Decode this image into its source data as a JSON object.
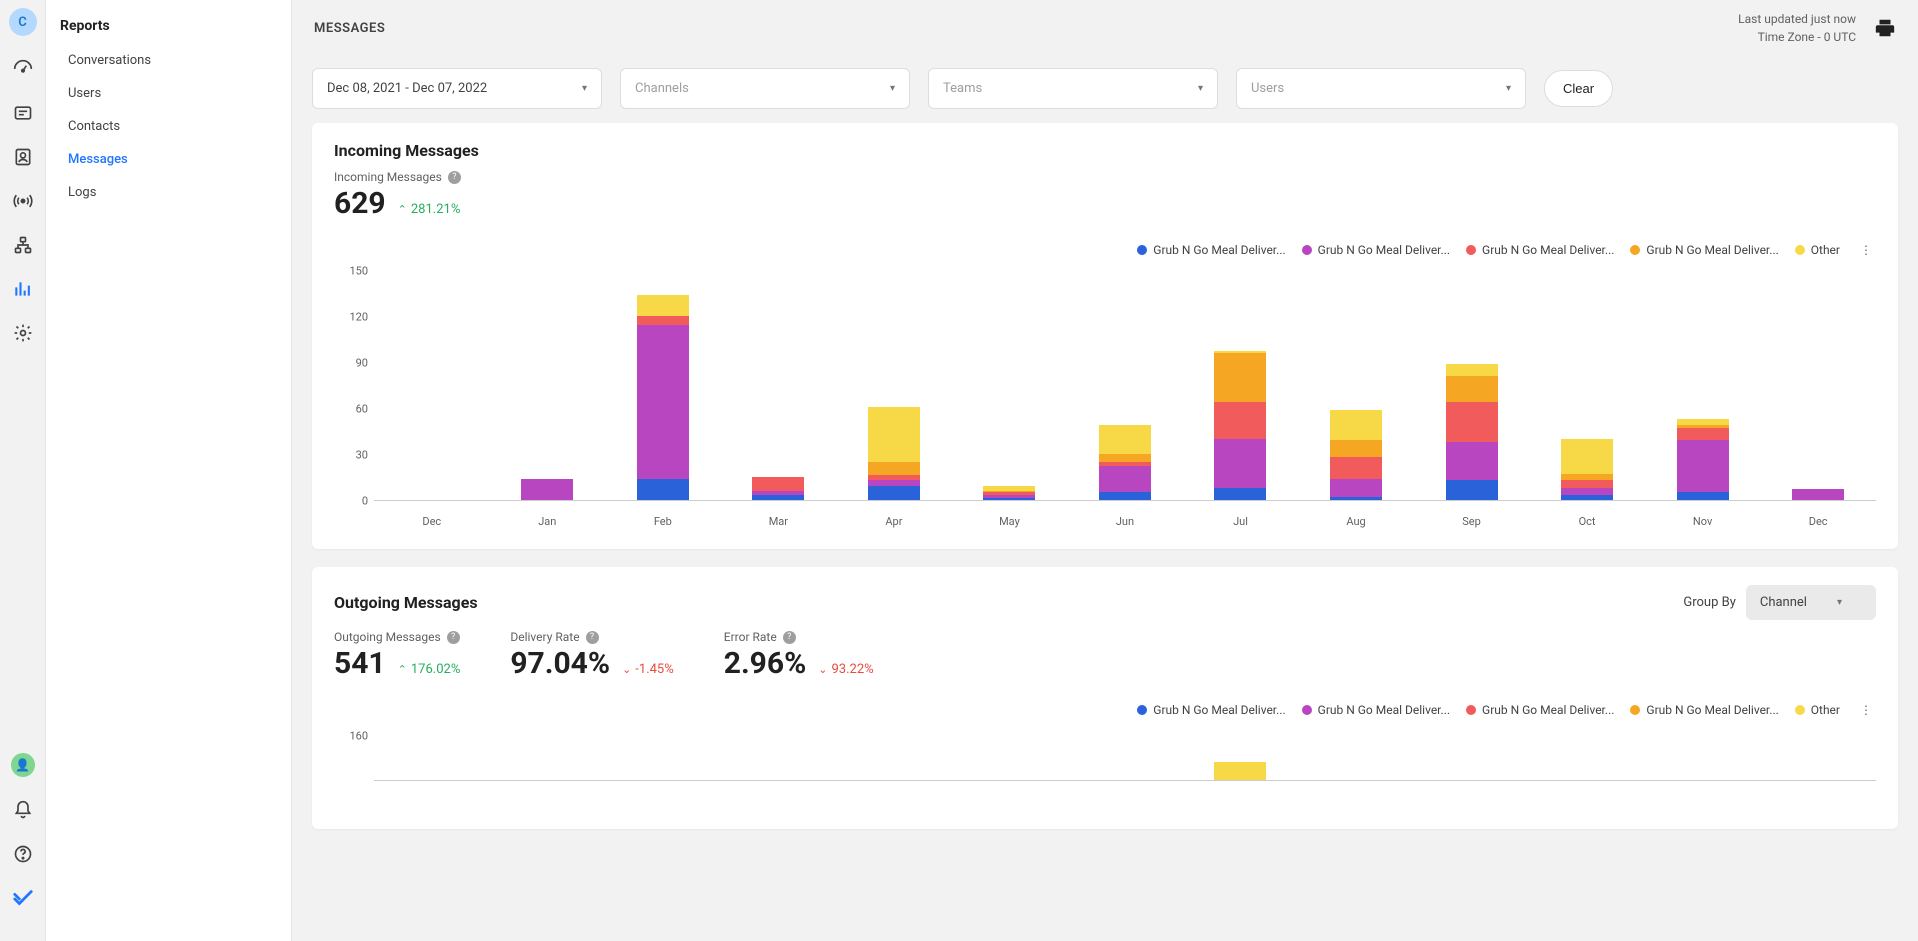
{
  "avatar_letter": "C",
  "sidebar": {
    "title": "Reports",
    "items": [
      "Conversations",
      "Users",
      "Contacts",
      "Messages",
      "Logs"
    ],
    "active_index": 3
  },
  "header": {
    "title": "MESSAGES",
    "last_updated": "Last updated just now",
    "timezone": "Time Zone - 0 UTC"
  },
  "filters": {
    "date_range": "Dec 08, 2021 - Dec 07, 2022",
    "channels_placeholder": "Channels",
    "teams_placeholder": "Teams",
    "users_placeholder": "Users",
    "clear_label": "Clear"
  },
  "legend": {
    "items": [
      {
        "label": "Grub N Go Meal Deliver...",
        "color": "#2962d9"
      },
      {
        "label": "Grub N Go Meal Deliver...",
        "color": "#b946c1"
      },
      {
        "label": "Grub N Go Meal Deliver...",
        "color": "#f15b5b"
      },
      {
        "label": "Grub N Go Meal Deliver...",
        "color": "#f5a623"
      },
      {
        "label": "Other",
        "color": "#f7d948"
      }
    ]
  },
  "incoming": {
    "title": "Incoming Messages",
    "stat_label": "Incoming Messages",
    "value": "629",
    "delta": "281.21%",
    "delta_direction": "up"
  },
  "outgoing": {
    "title": "Outgoing Messages",
    "group_by_label": "Group By",
    "group_by_value": "Channel",
    "stats": [
      {
        "label": "Outgoing Messages",
        "value": "541",
        "delta": "176.02%",
        "dir": "up"
      },
      {
        "label": "Delivery Rate",
        "value": "97.04%",
        "delta": "-1.45%",
        "dir": "down"
      },
      {
        "label": "Error Rate",
        "value": "2.96%",
        "delta": "93.22%",
        "dir": "down"
      }
    ],
    "y_ticks": [
      "160"
    ]
  },
  "chart_data": {
    "type": "bar",
    "title": "Incoming Messages",
    "xlabel": "",
    "ylabel": "",
    "ylim": [
      0,
      150
    ],
    "y_ticks": [
      0,
      30,
      60,
      90,
      120,
      150
    ],
    "categories": [
      "Dec",
      "Jan",
      "Feb",
      "Mar",
      "Apr",
      "May",
      "Jun",
      "Jul",
      "Aug",
      "Sep",
      "Oct",
      "Nov",
      "Dec"
    ],
    "series": [
      {
        "name": "Grub N Go Meal Deliver... (blue)",
        "color": "#2962d9",
        "values": [
          0,
          0,
          14,
          3,
          9,
          1,
          5,
          8,
          2,
          13,
          3,
          5,
          0
        ]
      },
      {
        "name": "Grub N Go Meal Deliver... (purple)",
        "color": "#b946c1",
        "values": [
          0,
          14,
          100,
          3,
          4,
          2,
          17,
          32,
          12,
          25,
          5,
          34,
          7
        ]
      },
      {
        "name": "Grub N Go Meal Deliver... (red)",
        "color": "#f15b5b",
        "values": [
          0,
          0,
          6,
          9,
          3,
          2,
          3,
          24,
          14,
          26,
          5,
          8,
          0
        ]
      },
      {
        "name": "Grub N Go Meal Deliver... (orange)",
        "color": "#f5a623",
        "values": [
          0,
          0,
          0,
          0,
          9,
          1,
          5,
          32,
          11,
          17,
          4,
          2,
          0
        ]
      },
      {
        "name": "Other (yellow)",
        "color": "#f7d948",
        "values": [
          0,
          0,
          14,
          0,
          36,
          3,
          19,
          1,
          20,
          8,
          23,
          4,
          0
        ]
      }
    ]
  }
}
